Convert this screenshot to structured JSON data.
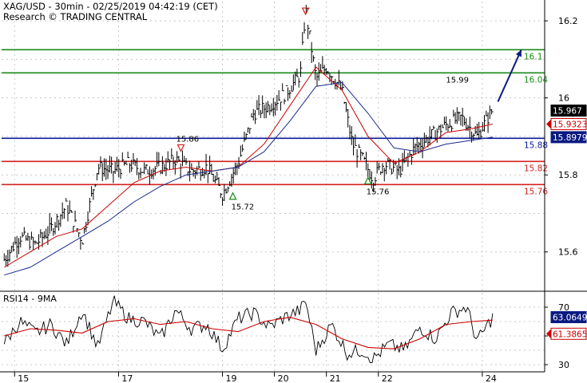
{
  "header": {
    "line1": "XAG/USD - 30min - 02/25/2019 04:42:19 (CET)",
    "line2": "Research © TRADING CENTRAL"
  },
  "colors": {
    "grid": "#c8c8c8",
    "price": "#000000",
    "ma_fast": "#cc0000",
    "ma_slow": "#1a2a8c",
    "resistance": "#1a8a1a",
    "support": "#d42020",
    "pivot": "#0a1a99",
    "arrow": "#0a1a80",
    "rsi": "#000000",
    "rsi_ma": "#cc0000",
    "badge_close": "#000000",
    "badge_red": "#cc0000",
    "badge_blue": "#0a1a80"
  },
  "chart_data": [
    {
      "type": "line",
      "subtype": "candlestick/bar price chart",
      "title": "XAG/USD - 30min - 02/25/2019 04:42:19 (CET)",
      "x_tick_labels": [
        "15",
        "17",
        "19",
        "20",
        "21",
        "22",
        "24"
      ],
      "x_day_values": [
        15.2,
        17.2,
        19.2,
        20.2,
        21.2,
        22.2,
        24.2
      ],
      "y_tick_labels": [
        "15.6",
        "15.8",
        "16",
        "16.2"
      ],
      "y_ticks": [
        15.6,
        15.8,
        16.0,
        16.2
      ],
      "ylim": [
        15.5,
        16.25
      ],
      "grid": true,
      "levels": [
        {
          "label": "16.1",
          "value": 16.125,
          "kind": "resistance"
        },
        {
          "label": "16.04",
          "value": 16.065,
          "kind": "resistance"
        },
        {
          "label": "15.88",
          "value": 15.895,
          "kind": "pivot"
        },
        {
          "label": "15.82",
          "value": 15.835,
          "kind": "support"
        },
        {
          "label": "15.76",
          "value": 15.775,
          "kind": "support"
        }
      ],
      "annotations": [
        {
          "text": "15.86",
          "x": 18.4,
          "y": 15.87,
          "marker": "down"
        },
        {
          "text": "15.72",
          "x": 19.4,
          "y": 15.745,
          "marker": "up"
        },
        {
          "text": "15.76",
          "x": 22.0,
          "y": 15.785,
          "marker": "up"
        },
        {
          "text": "15.99",
          "x": 23.5,
          "y": 16.04,
          "marker": "none"
        },
        {
          "text": "",
          "x": 20.8,
          "y": 16.225,
          "marker": "down"
        }
      ],
      "arrow": {
        "from": [
          24.5,
          15.99
        ],
        "to": [
          24.95,
          16.125
        ]
      },
      "price_badges": [
        {
          "text": "15.967",
          "value": 15.967,
          "style": "close"
        },
        {
          "text": "15.9323",
          "value": 15.932,
          "style": "ma_fast"
        },
        {
          "text": "15.8979",
          "value": 15.898,
          "style": "ma_slow"
        }
      ],
      "series": [
        {
          "name": "XAG/USD",
          "x": [
            15.0,
            15.3,
            15.6,
            15.9,
            16.2,
            16.5,
            16.8,
            17.1,
            17.4,
            17.7,
            18.0,
            18.3,
            18.6,
            18.9,
            19.2,
            19.5,
            19.8,
            20.1,
            20.4,
            20.7,
            20.8,
            21.0,
            21.2,
            21.5,
            21.7,
            21.9,
            22.1,
            22.3,
            22.6,
            22.9,
            23.2,
            23.5,
            23.8,
            24.1,
            24.4
          ],
          "values": [
            15.58,
            15.64,
            15.62,
            15.66,
            15.72,
            15.63,
            15.82,
            15.81,
            15.83,
            15.81,
            15.82,
            15.84,
            15.81,
            15.82,
            15.75,
            15.83,
            15.96,
            15.98,
            16.01,
            16.06,
            16.23,
            16.05,
            16.08,
            16.02,
            15.88,
            15.84,
            15.79,
            15.83,
            15.81,
            15.87,
            15.9,
            15.93,
            15.95,
            15.9,
            15.97
          ]
        },
        {
          "name": "MA fast",
          "x": [
            15.0,
            15.5,
            16.0,
            16.5,
            17.0,
            17.5,
            18.0,
            18.5,
            19.0,
            19.5,
            20.0,
            20.5,
            21.0,
            21.5,
            22.0,
            22.5,
            23.0,
            23.5,
            24.0,
            24.4
          ],
          "values": [
            15.56,
            15.6,
            15.64,
            15.66,
            15.72,
            15.78,
            15.81,
            15.82,
            15.81,
            15.82,
            15.88,
            15.98,
            16.08,
            16.02,
            15.9,
            15.83,
            15.86,
            15.91,
            15.92,
            15.932
          ]
        },
        {
          "name": "MA slow",
          "x": [
            15.0,
            15.5,
            16.0,
            16.5,
            17.0,
            17.5,
            18.0,
            18.5,
            19.0,
            19.5,
            20.0,
            20.5,
            21.0,
            21.5,
            22.0,
            22.5,
            23.0,
            23.5,
            24.0,
            24.4
          ],
          "values": [
            15.54,
            15.56,
            15.6,
            15.64,
            15.68,
            15.73,
            15.77,
            15.8,
            15.81,
            15.82,
            15.86,
            15.94,
            16.03,
            16.04,
            15.96,
            15.87,
            15.86,
            15.88,
            15.89,
            15.898
          ]
        }
      ]
    },
    {
      "type": "line",
      "title": "RSI14 - 9MA",
      "y_tick_labels": [
        "30",
        "50",
        "70"
      ],
      "y_ticks": [
        30,
        50,
        70
      ],
      "ylim": [
        25,
        80
      ],
      "grid": true,
      "value_badges": [
        {
          "text": "63.0649",
          "value": 63.06,
          "style": "rsi"
        },
        {
          "text": "61.3865",
          "value": 51.5,
          "style": "ma_fast"
        }
      ],
      "series": [
        {
          "name": "RSI14",
          "x": [
            15.0,
            15.3,
            15.6,
            15.9,
            16.2,
            16.5,
            16.8,
            17.1,
            17.4,
            17.7,
            18.0,
            18.3,
            18.6,
            18.9,
            19.2,
            19.5,
            19.8,
            20.1,
            20.4,
            20.7,
            20.8,
            21.0,
            21.3,
            21.6,
            21.9,
            22.1,
            22.4,
            22.7,
            23.0,
            23.3,
            23.6,
            23.9,
            24.1,
            24.4
          ],
          "values": [
            45,
            60,
            52,
            58,
            44,
            68,
            42,
            74,
            62,
            60,
            48,
            68,
            55,
            58,
            41,
            62,
            66,
            56,
            63,
            68,
            74,
            40,
            58,
            38,
            40,
            34,
            44,
            40,
            56,
            48,
            66,
            70,
            46,
            63
          ]
        },
        {
          "name": "9MA",
          "x": [
            15.0,
            15.5,
            16.0,
            16.5,
            17.0,
            17.5,
            18.0,
            18.5,
            19.0,
            19.5,
            20.0,
            20.5,
            21.0,
            21.5,
            22.0,
            22.5,
            23.0,
            23.5,
            24.0,
            24.4
          ],
          "values": [
            50,
            55,
            54,
            52,
            60,
            62,
            58,
            60,
            55,
            53,
            60,
            63,
            58,
            48,
            42,
            41,
            48,
            58,
            60,
            61
          ]
        }
      ]
    }
  ]
}
